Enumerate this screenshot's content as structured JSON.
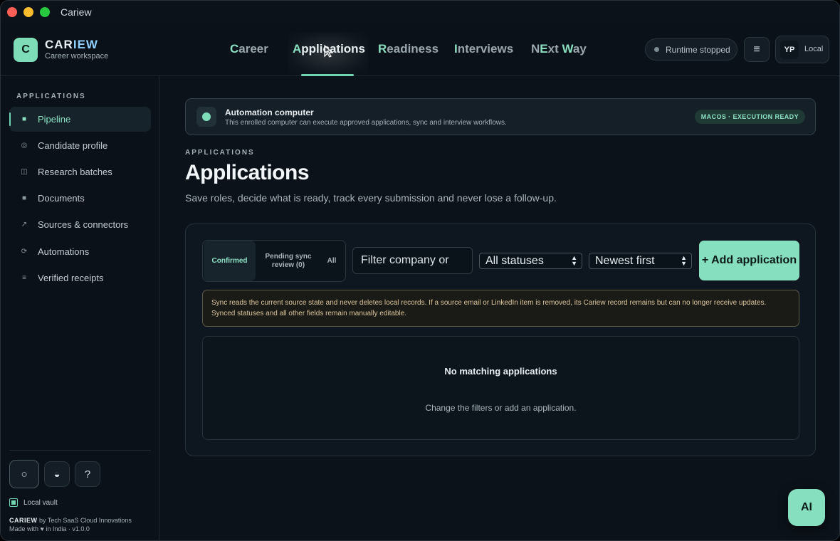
{
  "window": {
    "title": "Cariew"
  },
  "brand": {
    "logo_letter": "C",
    "name_part1": "CAR",
    "name_part2": "IEW",
    "subtitle": "Career workspace"
  },
  "nav": {
    "items": [
      {
        "cap": "C",
        "rest": "areer",
        "active": false
      },
      {
        "cap": "A",
        "rest": "pplications",
        "active": true
      },
      {
        "cap": "R",
        "rest": "eadiness",
        "active": false
      },
      {
        "cap": "I",
        "rest": "nterviews",
        "active": false
      },
      {
        "cap": "N",
        "mid": "E",
        "rest": "xt ",
        "cap2": "W",
        "rest2": "ay",
        "active": false
      }
    ]
  },
  "header": {
    "runtime_status": "Runtime stopped",
    "menu_icon": "≡",
    "user_initials": "YP",
    "user_mode": "Local"
  },
  "sidebar": {
    "heading": "APPLICATIONS",
    "items": [
      {
        "label": "Pipeline",
        "icon": "square-icon",
        "glyph": "■"
      },
      {
        "label": "Candidate profile",
        "icon": "circle-icon",
        "glyph": "◎"
      },
      {
        "label": "Research batches",
        "icon": "columns-icon",
        "glyph": "◫"
      },
      {
        "label": "Documents",
        "icon": "document-icon",
        "glyph": "■"
      },
      {
        "label": "Sources & connectors",
        "icon": "arrow-icon",
        "glyph": "↗"
      },
      {
        "label": "Automations",
        "icon": "loop-icon",
        "glyph": "⟳"
      },
      {
        "label": "Verified receipts",
        "icon": "list-icon",
        "glyph": "≡"
      }
    ],
    "tools": {
      "circle": "○",
      "contrast": "◒",
      "help": "?"
    },
    "vault_label": "Local vault",
    "credit_brand": "CARIEW",
    "credit_by": " by Tech SaaS Cloud Innovations",
    "credit_line2": "Made with ♥ in India · v1.0.0"
  },
  "banner": {
    "title": "Automation computer",
    "description": "This enrolled computer can execute approved applications, sync and interview workflows.",
    "badge": "MACOS · EXECUTION READY"
  },
  "page": {
    "section_label": "APPLICATIONS",
    "title": "Applications",
    "description": "Save roles, decide what is ready, track every submission and never lose a follow-up."
  },
  "filters": {
    "segments": [
      "Confirmed",
      "Pending sync review (0)",
      "All"
    ],
    "search_placeholder": "Filter company or",
    "status_select": "All statuses",
    "sort_select": "Newest first",
    "add_button": "+ Add application"
  },
  "notice": "Sync reads the current source state and never deletes local records. If a source email or LinkedIn item is removed, its Cariew record remains but can no longer receive updates. Synced statuses and all other fields remain manually editable.",
  "empty_state": {
    "title": "No matching applications",
    "description": "Change the filters or add an application."
  },
  "ai_button": "AI",
  "colors": {
    "accent": "#86e0c0",
    "background": "#0b1219",
    "notice_text": "#dcc69a"
  }
}
